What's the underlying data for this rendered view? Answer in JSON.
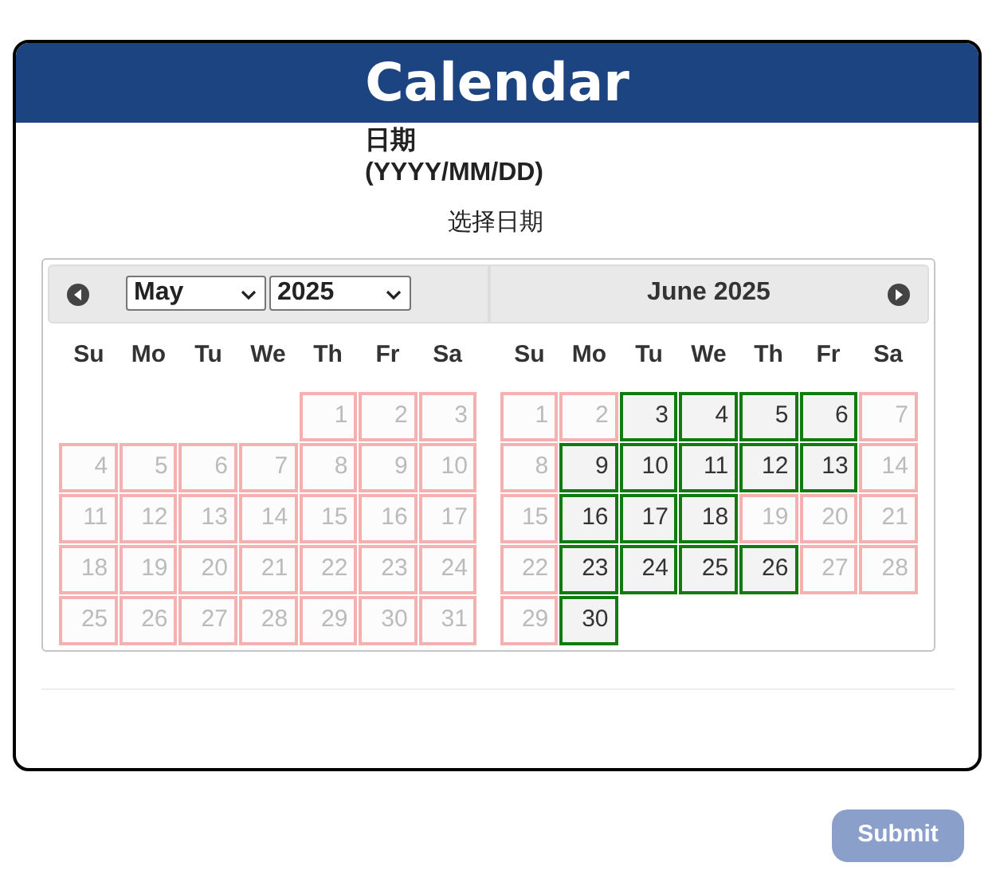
{
  "title": "Calendar",
  "field_label": "日期\n(YYYY/MM/DD)",
  "field_hint": "选择日期",
  "months": [
    {
      "kind": "selects",
      "month_select": "May",
      "year_select": "2025",
      "has_prev": true,
      "has_next": false,
      "weekdays": [
        "Su",
        "Mo",
        "Tu",
        "We",
        "Th",
        "Fr",
        "Sa"
      ],
      "cells": [
        {
          "kind": "blank"
        },
        {
          "kind": "blank"
        },
        {
          "kind": "blank"
        },
        {
          "kind": "blank"
        },
        {
          "kind": "day",
          "day": "1",
          "available": false
        },
        {
          "kind": "day",
          "day": "2",
          "available": false
        },
        {
          "kind": "day",
          "day": "3",
          "available": false
        },
        {
          "kind": "day",
          "day": "4",
          "available": false
        },
        {
          "kind": "day",
          "day": "5",
          "available": false
        },
        {
          "kind": "day",
          "day": "6",
          "available": false
        },
        {
          "kind": "day",
          "day": "7",
          "available": false
        },
        {
          "kind": "day",
          "day": "8",
          "available": false
        },
        {
          "kind": "day",
          "day": "9",
          "available": false
        },
        {
          "kind": "day",
          "day": "10",
          "available": false
        },
        {
          "kind": "day",
          "day": "11",
          "available": false
        },
        {
          "kind": "day",
          "day": "12",
          "available": false
        },
        {
          "kind": "day",
          "day": "13",
          "available": false
        },
        {
          "kind": "day",
          "day": "14",
          "available": false
        },
        {
          "kind": "day",
          "day": "15",
          "available": false
        },
        {
          "kind": "day",
          "day": "16",
          "available": false
        },
        {
          "kind": "day",
          "day": "17",
          "available": false
        },
        {
          "kind": "day",
          "day": "18",
          "available": false
        },
        {
          "kind": "day",
          "day": "19",
          "available": false
        },
        {
          "kind": "day",
          "day": "20",
          "available": false
        },
        {
          "kind": "day",
          "day": "21",
          "available": false
        },
        {
          "kind": "day",
          "day": "22",
          "available": false
        },
        {
          "kind": "day",
          "day": "23",
          "available": false
        },
        {
          "kind": "day",
          "day": "24",
          "available": false
        },
        {
          "kind": "day",
          "day": "25",
          "available": false
        },
        {
          "kind": "day",
          "day": "26",
          "available": false
        },
        {
          "kind": "day",
          "day": "27",
          "available": false
        },
        {
          "kind": "day",
          "day": "28",
          "available": false
        },
        {
          "kind": "day",
          "day": "29",
          "available": false
        },
        {
          "kind": "day",
          "day": "30",
          "available": false
        },
        {
          "kind": "day",
          "day": "31",
          "available": false
        }
      ]
    },
    {
      "kind": "title",
      "title": "June 2025",
      "has_prev": false,
      "has_next": true,
      "weekdays": [
        "Su",
        "Mo",
        "Tu",
        "We",
        "Th",
        "Fr",
        "Sa"
      ],
      "cells": [
        {
          "kind": "day",
          "day": "1",
          "available": false
        },
        {
          "kind": "day",
          "day": "2",
          "available": false
        },
        {
          "kind": "day",
          "day": "3",
          "available": true
        },
        {
          "kind": "day",
          "day": "4",
          "available": true
        },
        {
          "kind": "day",
          "day": "5",
          "available": true
        },
        {
          "kind": "day",
          "day": "6",
          "available": true
        },
        {
          "kind": "day",
          "day": "7",
          "available": false
        },
        {
          "kind": "day",
          "day": "8",
          "available": false
        },
        {
          "kind": "day",
          "day": "9",
          "available": true
        },
        {
          "kind": "day",
          "day": "10",
          "available": true
        },
        {
          "kind": "day",
          "day": "11",
          "available": true
        },
        {
          "kind": "day",
          "day": "12",
          "available": true
        },
        {
          "kind": "day",
          "day": "13",
          "available": true
        },
        {
          "kind": "day",
          "day": "14",
          "available": false
        },
        {
          "kind": "day",
          "day": "15",
          "available": false
        },
        {
          "kind": "day",
          "day": "16",
          "available": true
        },
        {
          "kind": "day",
          "day": "17",
          "available": true
        },
        {
          "kind": "day",
          "day": "18",
          "available": true
        },
        {
          "kind": "day",
          "day": "19",
          "available": false
        },
        {
          "kind": "day",
          "day": "20",
          "available": false
        },
        {
          "kind": "day",
          "day": "21",
          "available": false
        },
        {
          "kind": "day",
          "day": "22",
          "available": false
        },
        {
          "kind": "day",
          "day": "23",
          "available": true
        },
        {
          "kind": "day",
          "day": "24",
          "available": true
        },
        {
          "kind": "day",
          "day": "25",
          "available": true
        },
        {
          "kind": "day",
          "day": "26",
          "available": true
        },
        {
          "kind": "day",
          "day": "27",
          "available": false
        },
        {
          "kind": "day",
          "day": "28",
          "available": false
        },
        {
          "kind": "day",
          "day": "29",
          "available": false
        },
        {
          "kind": "day",
          "day": "30",
          "available": true
        }
      ]
    }
  ],
  "submit": "Submit"
}
